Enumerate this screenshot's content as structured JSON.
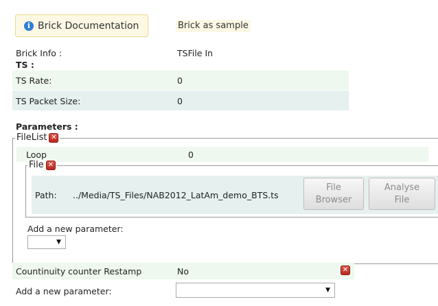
{
  "header": {
    "doc_button_label": "Brick Documentation",
    "sample_label": "Brick as sample"
  },
  "brick_info": {
    "label": "Brick Info :",
    "value": "TSFile In"
  },
  "ts": {
    "heading": "TS :",
    "rows": [
      {
        "label": "TS Rate:",
        "value": "0"
      },
      {
        "label": "TS Packet Size:",
        "value": "0"
      }
    ]
  },
  "parameters": {
    "heading": "Parameters :",
    "filelist": {
      "legend": "FileList",
      "loop_label": "Loop",
      "loop_value": "0",
      "file": {
        "legend": "File",
        "path_label": "Path:",
        "path_value": "../Media/TS_Files/NAB2012_LatAm_demo_BTS.ts",
        "browse_button": "File Browser",
        "analyse_button": "Analyse File"
      },
      "add_param_label": "Add a new parameter:"
    },
    "continuity": {
      "label": "Countinuity counter Restamp",
      "value": "No"
    },
    "add_param_label": "Add a new parameter:"
  },
  "icons": {
    "info": "info-icon",
    "delete": "delete-icon",
    "dropdown": "chevron-down-icon"
  },
  "colors": {
    "info_blue": "#2f7fd8",
    "delete_red": "#c9362b",
    "row_green": "#eef8ee",
    "row_blue": "#e6f0ef"
  }
}
